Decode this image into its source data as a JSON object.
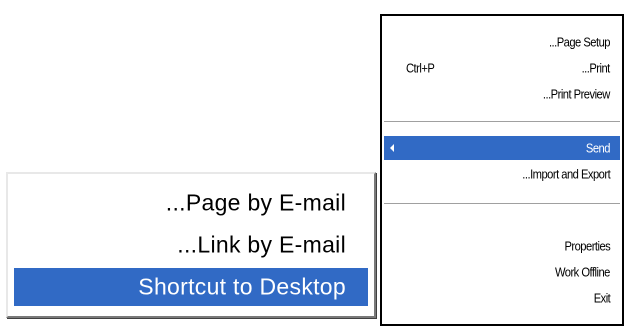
{
  "main_menu": {
    "items": [
      {
        "label": "...Page Setup",
        "shortcut": ""
      },
      {
        "label": "...Print",
        "shortcut": "Ctrl+P"
      },
      {
        "label": "...Print Preview",
        "shortcut": ""
      },
      {
        "label": "Send",
        "shortcut": "",
        "has_submenu": true,
        "highlighted": true
      },
      {
        "label": "...Import and Export",
        "shortcut": ""
      },
      {
        "label": "Properties",
        "shortcut": ""
      },
      {
        "label": "Work Offline",
        "shortcut": ""
      },
      {
        "label": "Exit",
        "shortcut": ""
      }
    ]
  },
  "send_submenu": {
    "items": [
      {
        "label": "...Page by E-mail"
      },
      {
        "label": "...Link by E-mail"
      },
      {
        "label": "Shortcut to Desktop",
        "highlighted": true
      }
    ]
  },
  "colors": {
    "highlight": "#316ac5",
    "highlight_text": "#ffffff",
    "menu_background": "#ffffff",
    "separator": "#a0a0a0"
  },
  "icons": {
    "submenu_arrow": "triangle-left-icon"
  }
}
